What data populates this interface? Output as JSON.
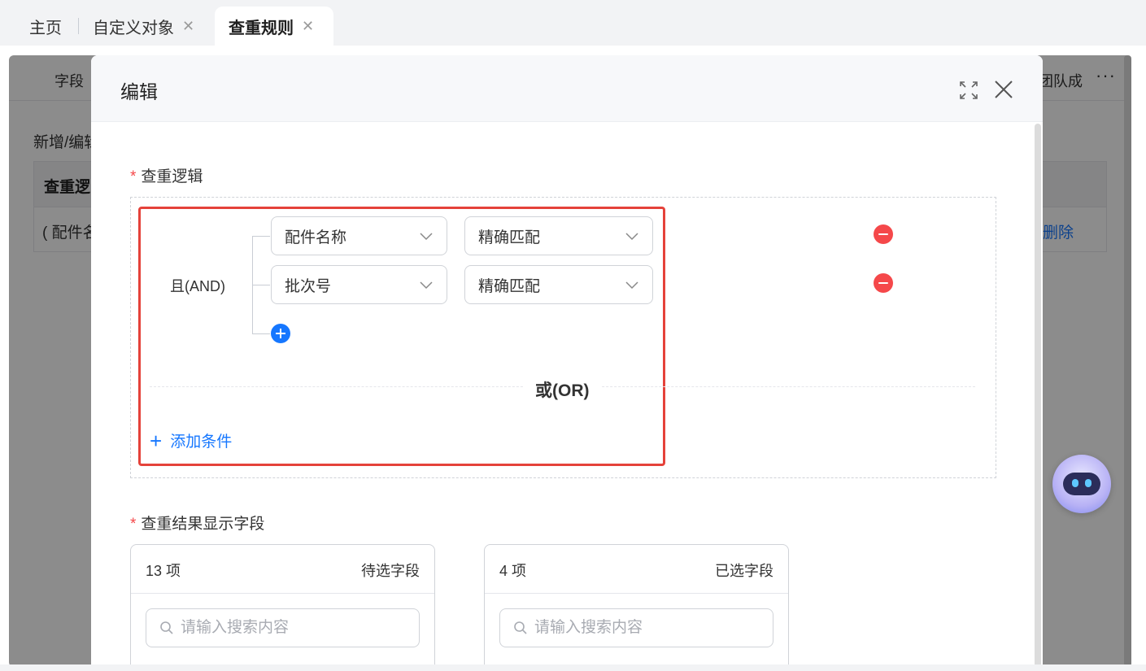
{
  "tabs": {
    "home": "主页",
    "custom_object": "自定义对象",
    "duplicate_rules": "查重规则"
  },
  "background_page": {
    "subnav_field": "字段",
    "subnav_team": "团队成",
    "subnav_more": "···",
    "heading": "新增/编辑",
    "table_header": "查重逻",
    "row_logic": "( 配件名",
    "row_delete": "删除"
  },
  "modal": {
    "title": "编辑",
    "logic_label": "查重逻辑",
    "required_mark": "*",
    "and_label": "且(AND)",
    "conditions": [
      {
        "field": "配件名称",
        "match": "精确匹配"
      },
      {
        "field": "批次号",
        "match": "精确匹配"
      }
    ],
    "or_label": "或(OR)",
    "add_condition": "添加条件",
    "result_label": "查重结果显示字段",
    "transfer_left": {
      "count": "13 项",
      "title": "待选字段",
      "search_placeholder": "请输入搜索内容"
    },
    "transfer_right": {
      "count": "4 项",
      "title": "已选字段",
      "search_placeholder": "请输入搜索内容"
    }
  },
  "colors": {
    "accent": "#1677ff",
    "danger": "#f5484a",
    "highlight_border": "#e5423a"
  },
  "icons": {
    "expand": "expand-icon",
    "close": "close-icon",
    "chevron": "chevron-down-icon",
    "remove": "minus-circle-icon",
    "add": "plus-circle-icon",
    "search": "search-icon",
    "assistant": "robot-icon"
  }
}
